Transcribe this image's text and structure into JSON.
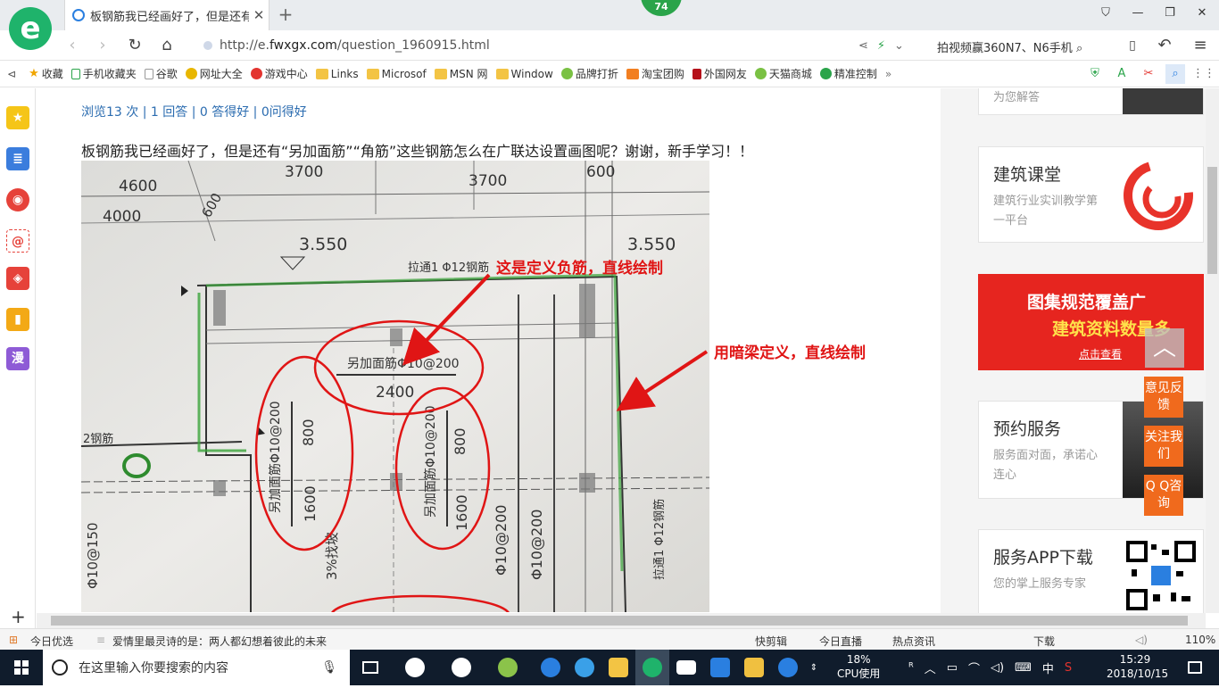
{
  "browser": {
    "tab_title": "板钢筋我已经画好了，但是还有",
    "badge_count": "74",
    "url_prefix": "http://e.",
    "url_host": "fwxgx.com",
    "url_path": "/question_1960915.html",
    "search_hint": "拍视频赢360N7、N6手机",
    "accent": "#1fb36b"
  },
  "bookmarks": [
    {
      "label": "收藏",
      "icon": "star-icon"
    },
    {
      "label": "手机收藏夹",
      "icon": "phone-icon"
    },
    {
      "label": "谷歌",
      "icon": "page-icon"
    },
    {
      "label": "网址大全",
      "icon": "globe-icon"
    },
    {
      "label": "游戏中心",
      "icon": "game-icon"
    },
    {
      "label": "Links",
      "icon": "folder-icon"
    },
    {
      "label": "Microsof",
      "icon": "folder-icon"
    },
    {
      "label": "MSN 网",
      "icon": "folder-icon"
    },
    {
      "label": "Window",
      "icon": "folder-icon"
    },
    {
      "label": "品牌打折",
      "icon": "leaf-icon"
    },
    {
      "label": "淘宝团购",
      "icon": "taobao-icon"
    },
    {
      "label": "外国网友",
      "icon": "bookmark-icon"
    },
    {
      "label": "天猫商城",
      "icon": "leaf-icon"
    },
    {
      "label": "精准控制",
      "icon": "wechat-icon"
    }
  ],
  "main": {
    "stats": "浏览13 次 | 1 回答 | 0 答得好 | 0问得好",
    "question": "板钢筋我已经画好了，但是还有“另加面筋”“角筋”这些钢筋怎么在广联达设置画图呢？谢谢，新手学习！！",
    "annotation_1": "这是定义负筋，直线绘制",
    "annotation_2": "用暗梁定义，直线绘制",
    "drawing": {
      "dim_4600": "4600",
      "dim_4000": "4000",
      "dim_3700a": "3700",
      "dim_3700b": "3700",
      "dim_600a": "600",
      "dim_600b": "600",
      "level_a": "3.550",
      "level_b": "3.550",
      "note_top": "拉通1 Φ12钢筋",
      "extra_bar": "另加面筋Φ10@200",
      "len_2400": "2400",
      "left_extra": "另加面筋Φ10@200",
      "left_800": "800",
      "left_1600": "1600",
      "mid_extra": "另加面筋Φ10@200",
      "mid_800": "800",
      "mid_1600": "1600",
      "slope": "3%找坡",
      "bar_a": "Φ10@200",
      "bar_b": "Φ10@200",
      "bar_150": "Φ10@150",
      "right_note": "拉通1 Φ12钢筋",
      "left_note": "2钢筋"
    }
  },
  "right": {
    "top_card_text": "为您解答",
    "card1_title": "建筑课堂",
    "card1_sub": "建筑行业实训教学第一平台",
    "banner_line1": "图集规范覆盖广",
    "banner_line2": "建筑资料数量多",
    "banner_btn": "点击查看",
    "card2_title": "预约服务",
    "card2_sub": "服务面对面，承诺心连心",
    "card3_title": "服务APP下载",
    "card3_sub": "您的掌上服务专家",
    "float_feedback": "意见反馈",
    "float_follow": "关注我们",
    "float_qq": "Q Q咨询"
  },
  "statusbar": {
    "daily": "今日优选",
    "news": "爱情里最灵诗的是：两人都幻想着彼此的未来",
    "clip": "快剪辑",
    "live": "今日直播",
    "hot": "热点资讯",
    "download": "下载",
    "zoom": "110%"
  },
  "taskbar": {
    "search_placeholder": "在这里输入你要搜索的内容",
    "cpu_pct": "18%",
    "cpu_label": "CPU使用",
    "ime": "中",
    "time": "15:29",
    "date": "2018/10/15"
  }
}
